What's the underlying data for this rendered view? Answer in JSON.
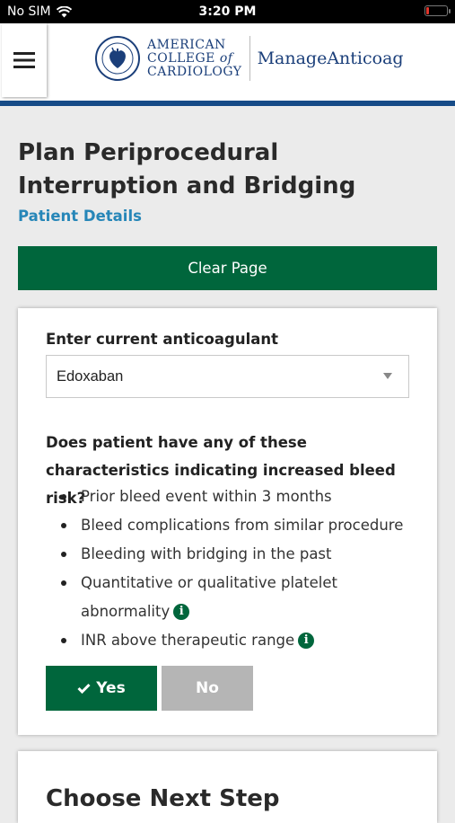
{
  "status_bar": {
    "carrier": "No SIM",
    "time": "3:20 PM"
  },
  "header": {
    "org_line1": "AMERICAN",
    "org_line2a": "COLLEGE",
    "org_line2b": "of",
    "org_line3": "CARDIOLOGY",
    "app_name": "ManageAnticoag"
  },
  "page": {
    "title": "Plan Periprocedural Interruption and Bridging",
    "subtitle_link": "Patient Details",
    "clear_button": "Clear Page"
  },
  "form": {
    "anticoagulant_label": "Enter current anticoagulant",
    "anticoagulant_value": "Edoxaban",
    "bleed_question": "Does patient have any of these characteristics indicating increased bleed risk?",
    "risk_items": [
      "Prior bleed event within 3 months",
      "Bleed complications from similar procedure",
      "Bleeding with bridging in the past",
      "Quantitative or qualitative platelet abnormality",
      "INR above therapeutic range"
    ],
    "yes_label": "Yes",
    "no_label": "No",
    "selected": "Yes"
  },
  "next_section": {
    "title": "Choose Next Step"
  },
  "colors": {
    "primary_green": "#00663c",
    "link_blue": "#2686b8",
    "brand_navy": "#1b3f7a",
    "inactive_gray": "#b5b5b5"
  },
  "icons": [
    "wifi-icon",
    "battery-icon",
    "hamburger-menu-icon",
    "acc-seal-icon",
    "info-icon",
    "check-icon",
    "dropdown-caret-icon"
  ]
}
